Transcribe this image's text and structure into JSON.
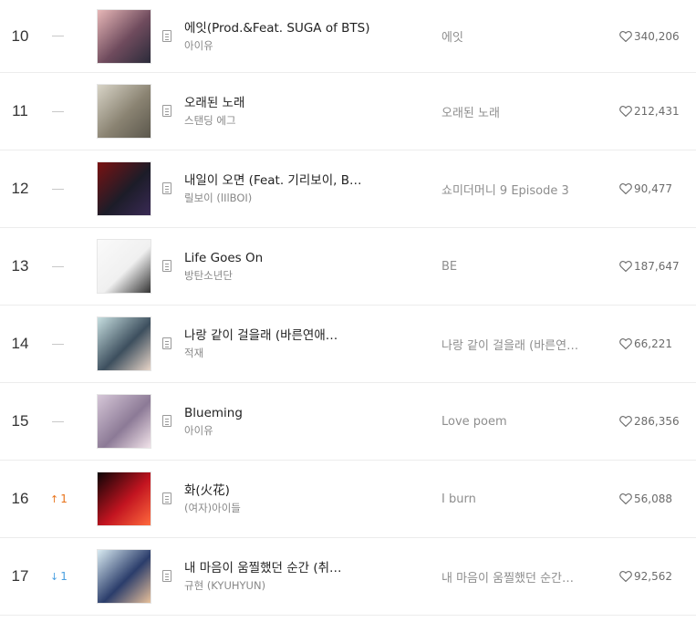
{
  "chart": {
    "rows": [
      {
        "rank": "10",
        "change_dir": "none",
        "change": "",
        "title": "에잇(Prod.&Feat. SUGA of BTS)",
        "artist": "아이유",
        "album": "에잇",
        "likes": "340,206",
        "cover_colors": [
          "#e7b7b7",
          "#6f4b5d",
          "#2b2b3a"
        ]
      },
      {
        "rank": "11",
        "change_dir": "none",
        "change": "",
        "title": "오래된 노래",
        "artist": "스탠딩 에그",
        "album": "오래된 노래",
        "likes": "212,431",
        "cover_colors": [
          "#d8d4c7",
          "#8a8372",
          "#5b574c"
        ]
      },
      {
        "rank": "12",
        "change_dir": "none",
        "change": "",
        "title": "내일이 오면 (Feat. 기리보이, B…",
        "artist": "릴보이 (lIlBOI)",
        "album": "쇼미더머니 9 Episode 3",
        "likes": "90,477",
        "cover_colors": [
          "#7a1212",
          "#1c1c28",
          "#3a2a55"
        ]
      },
      {
        "rank": "13",
        "change_dir": "none",
        "change": "",
        "title": "Life Goes On",
        "artist": "방탄소년단",
        "album": "BE",
        "likes": "187,647",
        "cover_colors": [
          "#fafafa",
          "#f0f0f0",
          "#333333"
        ]
      },
      {
        "rank": "14",
        "change_dir": "none",
        "change": "",
        "title": "나랑 같이 걸을래 (바른연애…",
        "artist": "적재",
        "album": "나랑 같이 걸을래 (바른연…",
        "likes": "66,221",
        "cover_colors": [
          "#c7dfe0",
          "#3d4f5e",
          "#e8d5c8"
        ]
      },
      {
        "rank": "15",
        "change_dir": "none",
        "change": "",
        "title": "Blueming",
        "artist": "아이유",
        "album": "Love poem",
        "likes": "286,356",
        "cover_colors": [
          "#d6c7d8",
          "#8c7a96",
          "#f2e3ea"
        ]
      },
      {
        "rank": "16",
        "change_dir": "up",
        "change": "1",
        "title": "화(火花)",
        "artist": "(여자)아이들",
        "album": "I burn",
        "likes": "56,088",
        "cover_colors": [
          "#0d0406",
          "#c21420",
          "#ff6a3d"
        ]
      },
      {
        "rank": "17",
        "change_dir": "down",
        "change": "1",
        "title": "내 마음이 움찔했던 순간 (취…",
        "artist": "규현 (KYUHYUN)",
        "album": "내 마음이 움찔했던 순간…",
        "likes": "92,562",
        "cover_colors": [
          "#d9ebf2",
          "#2b3d6b",
          "#e8c09a"
        ]
      }
    ]
  }
}
